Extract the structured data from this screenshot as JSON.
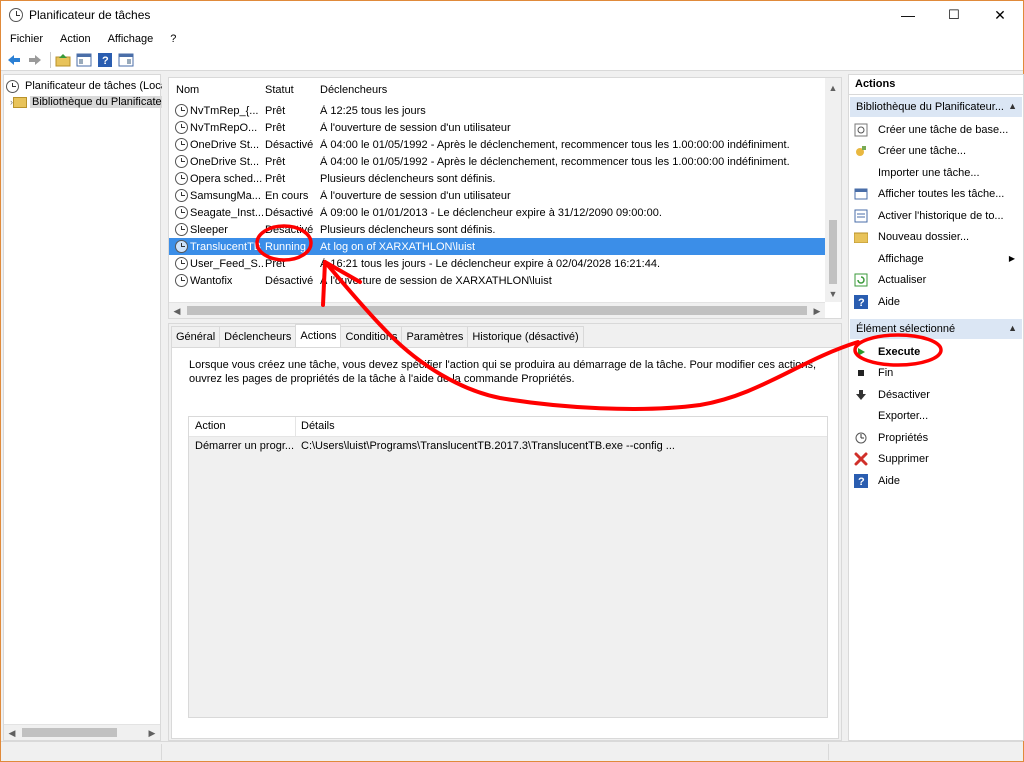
{
  "window": {
    "title": "Planificateur de tâches",
    "minimize": "—",
    "maximize": "☐",
    "close": "✕"
  },
  "menu": [
    "Fichier",
    "Action",
    "Affichage",
    "?"
  ],
  "tree": {
    "root": "Planificateur de tâches (Local)",
    "child": "Bibliothèque du Planificateur de tâches"
  },
  "tasks": {
    "columns": {
      "name": "Nom",
      "status": "Statut",
      "triggers": "Déclencheurs"
    },
    "rows": [
      {
        "name": "NvTmRep_{...",
        "status": "Prêt",
        "trigger": "À 12:25 tous les jours"
      },
      {
        "name": "NvTmRepO...",
        "status": "Prêt",
        "trigger": "À l'ouverture de session d'un utilisateur"
      },
      {
        "name": "OneDrive St...",
        "status": "Désactivé",
        "trigger": "À 04:00 le 01/05/1992 - Après le déclenchement, recommencer tous les 1.00:00:00 indéfiniment."
      },
      {
        "name": "OneDrive St...",
        "status": "Prêt",
        "trigger": "À 04:00 le 01/05/1992 - Après le déclenchement, recommencer tous les 1.00:00:00 indéfiniment."
      },
      {
        "name": "Opera sched...",
        "status": "Prêt",
        "trigger": "Plusieurs déclencheurs sont définis."
      },
      {
        "name": "SamsungMa...",
        "status": "En cours",
        "trigger": "À l'ouverture de session d'un utilisateur"
      },
      {
        "name": "Seagate_Inst...",
        "status": "Désactivé",
        "trigger": "À 09:00 le 01/01/2013 - Le déclencheur expire à 31/12/2090 09:00:00."
      },
      {
        "name": "Sleeper",
        "status": "Désactivé",
        "trigger": "Plusieurs déclencheurs sont définis."
      },
      {
        "name": "TranslucentTB",
        "status": "Running",
        "trigger": "At log on of                        XARXATHLON\\luist"
      },
      {
        "name": "User_Feed_S...",
        "status": "Prêt",
        "trigger": "À 16:21 tous les jours - Le déclencheur expire à 02/04/2028 16:21:44."
      },
      {
        "name": "Wantofix",
        "status": "Désactivé",
        "trigger": "À l'ouverture de session de XARXATHLON\\luist"
      }
    ]
  },
  "tabs": [
    "Général",
    "Déclencheurs",
    "Actions",
    "Conditions",
    "Paramètres",
    "Historique (désactivé)"
  ],
  "actions_tab": {
    "description": "Lorsque vous créez une tâche, vous devez spécifier l'action qui se produira au démarrage de la tâche. Pour modifier ces actions, ouvrez les pages de propriétés de la tâche à l'aide de la commande Propriétés.",
    "columns": {
      "action": "Action",
      "details": "Détails"
    },
    "rows": [
      {
        "action": "Démarrer un progr...",
        "details": "C:\\Users\\luist\\Programs\\TranslucentTB.2017.3\\TranslucentTB.exe --config ..."
      }
    ]
  },
  "actions_pane": {
    "title": "Actions",
    "section1": "Bibliothèque du Planificateur...",
    "section1_items": [
      {
        "label": "Créer une tâche de base...",
        "icon": "create-basic-task-icon"
      },
      {
        "label": "Créer une tâche...",
        "icon": "create-task-icon"
      },
      {
        "label": "Importer une tâche...",
        "icon": "none"
      },
      {
        "label": "Afficher toutes les tâche...",
        "icon": "display-tasks-icon"
      },
      {
        "label": "Activer l'historique de to...",
        "icon": "history-icon"
      },
      {
        "label": "Nouveau dossier...",
        "icon": "folder-icon"
      },
      {
        "label": "Affichage",
        "icon": "none"
      },
      {
        "label": "Actualiser",
        "icon": "refresh-icon"
      },
      {
        "label": "Aide",
        "icon": "help-icon"
      }
    ],
    "section2": "Élément sélectionné",
    "section2_items": [
      {
        "label": "Execute",
        "icon": "play-icon"
      },
      {
        "label": "Fin",
        "icon": "stop-icon"
      },
      {
        "label": "Désactiver",
        "icon": "disable-icon"
      },
      {
        "label": "Exporter...",
        "icon": "none"
      },
      {
        "label": "Propriétés",
        "icon": "properties-icon"
      },
      {
        "label": "Supprimer",
        "icon": "delete-icon"
      },
      {
        "label": "Aide",
        "icon": "help-icon"
      }
    ]
  },
  "colors": {
    "selection": "#3b8ee8",
    "annotation": "#ff0000",
    "section": "#dbe6f4"
  }
}
